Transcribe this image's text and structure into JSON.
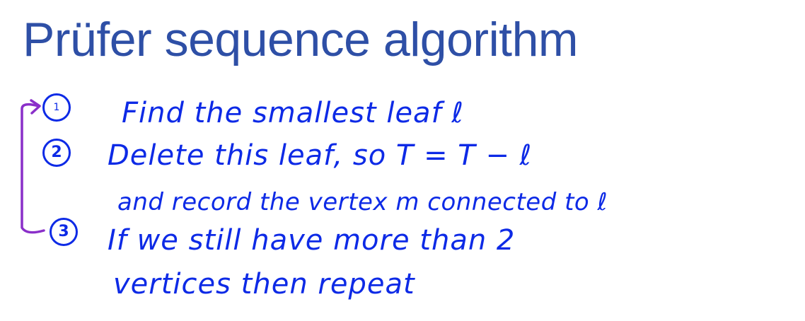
{
  "title": "Prüfer sequence algorithm",
  "steps": [
    {
      "number": "1",
      "lines": [
        "Find the smallest leaf ℓ"
      ]
    },
    {
      "number": "2",
      "lines": [
        "Delete this leaf, so T = T − ℓ",
        "and record the vertex m connected to ℓ"
      ]
    },
    {
      "number": "3",
      "lines": [
        "If we still have more than 2",
        "vertices then repeat"
      ]
    }
  ],
  "colors": {
    "title": "#2e4fa6",
    "ink": "#0d2ae6",
    "loop_arrow": "#8a2fc9"
  }
}
